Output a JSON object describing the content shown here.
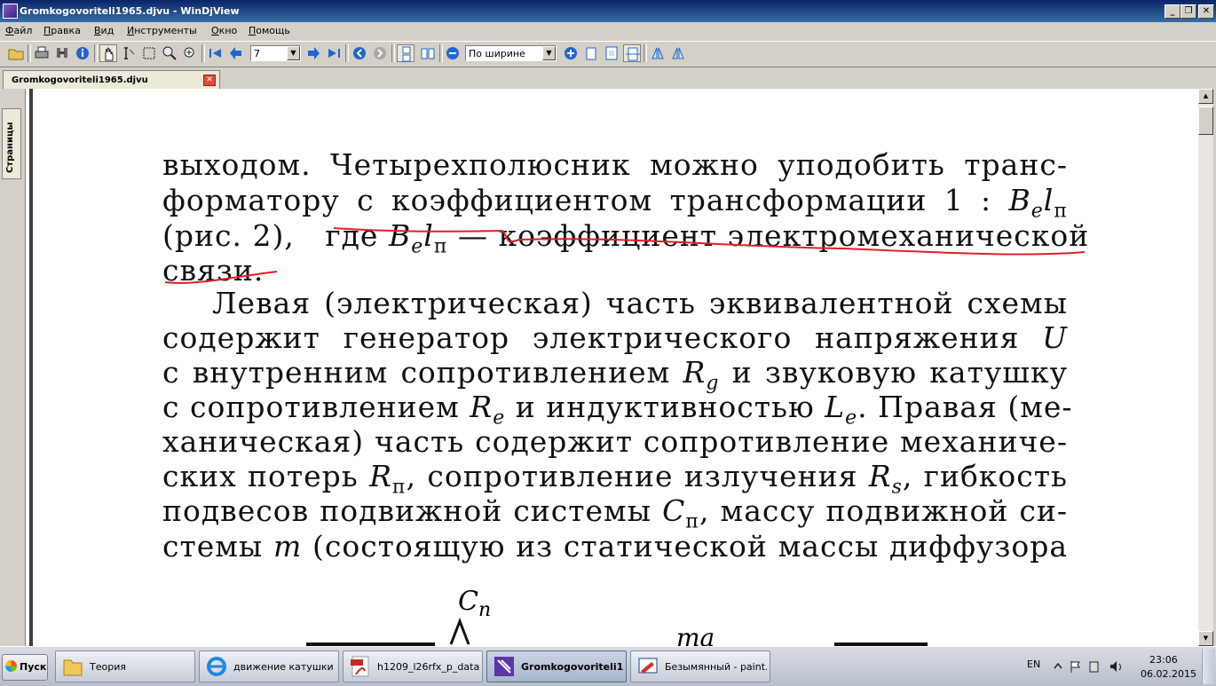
{
  "window": {
    "title": "Gromkogovoriteli1965.djvu - WinDjView",
    "buttons": {
      "minimize": "_",
      "restore": "❐",
      "close": "✕"
    }
  },
  "menu": [
    "Файл",
    "Правка",
    "Вид",
    "Инструменты",
    "Окно",
    "Помощь"
  ],
  "toolbar": {
    "page_number": "7",
    "zoom": "По ширине",
    "combo_arrow": "▼"
  },
  "tab": {
    "title": "Gromkogovoriteli1965.djvu",
    "close": "✕"
  },
  "side_panel": {
    "tab_label": "Страницы"
  },
  "scrollbar": {
    "up": "▲",
    "down": "▼"
  },
  "document": {
    "lines": [
      [
        "выходом.",
        "Четырехполюсник",
        "можно",
        "уподобить",
        "транс-"
      ],
      [
        "форматору",
        "с",
        "коэффициентом",
        "трансформации",
        "1 : "
      ],
      [
        "(рис.",
        "2),",
        "где"
      ],
      [
        "связи."
      ],
      [
        "Левая",
        "(электрическая)",
        "часть",
        "эквивалентной",
        "схемы"
      ],
      [
        "содержит",
        "генератор",
        "электрического",
        "напряжения"
      ],
      [
        "с",
        "внутренним",
        "сопротивлением",
        "и",
        "звуковую",
        "катушку"
      ],
      [
        "с",
        "сопротивлением",
        "и",
        "индуктивностью",
        "Правая",
        "(ме-"
      ],
      [
        "ханическая)",
        "часть",
        "содержит",
        "сопротивление",
        "механиче-"
      ],
      [
        "ских",
        "потерь",
        "сопротивление",
        "излучения",
        "гибкость"
      ],
      [
        "подвесов",
        "подвижной",
        "системы",
        "массу",
        "подвижной",
        "си-"
      ],
      [
        "стемы",
        "(состоящую",
        "из",
        "статической",
        "массы",
        "диффузора"
      ]
    ],
    "symbols": {
      "B": "B",
      "e": "e",
      "l": "l",
      "p": "п",
      "dash": "—",
      "coupling_tail": "коэффициент электромеханической",
      "U": "U",
      "Rg": "R",
      "g": "g",
      "Re": "R",
      "Le": "L",
      "Le_dot": ".",
      "Rp": "R",
      "Rp_comma": ",",
      "Rs": "R",
      "s": "s",
      "Rs_comma": ",",
      "Cp": "C",
      "Cp_comma": ",",
      "m": "m"
    },
    "figure": {
      "cp_label": "С",
      "cp_sub": "п",
      "m_label": "mа"
    }
  },
  "taskbar": {
    "start": "Пуск",
    "tasks": [
      {
        "label": "Теория",
        "icon": "folder-icon"
      },
      {
        "label": "движение катушки ...",
        "icon": "ie-icon"
      },
      {
        "label": "h1209_l26rfx_p_data....",
        "icon": "pdf-icon"
      },
      {
        "label": "Gromkogovoriteli1...",
        "icon": "windjview-icon",
        "active": true
      },
      {
        "label": "Безымянный - paint....",
        "icon": "paint-icon"
      }
    ],
    "lang": "EN",
    "time": "23:06",
    "date": "06.02.2015"
  },
  "colors": {
    "titlebar": "#0a246a",
    "annotation": "#e0202a",
    "chrome": "#d4d0c8"
  }
}
